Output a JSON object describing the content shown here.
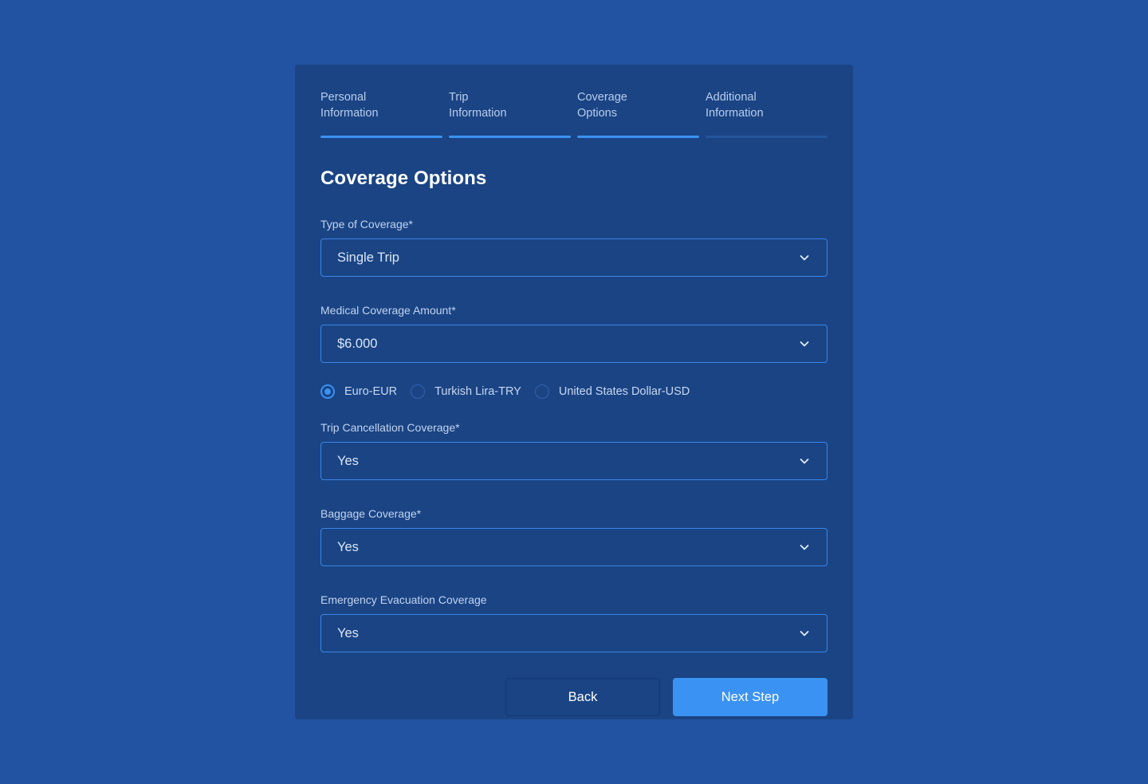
{
  "steps": [
    {
      "label": "Personal\nInformation",
      "state": "complete"
    },
    {
      "label": "Trip\nInformation",
      "state": "complete"
    },
    {
      "label": "Coverage\nOptions",
      "state": "active"
    },
    {
      "label": "Additional\nInformation",
      "state": "inactive"
    }
  ],
  "form": {
    "title": "Coverage Options",
    "type_of_coverage": {
      "label": "Type of Coverage*",
      "value": "Single Trip"
    },
    "medical_amount": {
      "label": "Medical Coverage Amount*",
      "value": "$6.000"
    },
    "currency": {
      "options": [
        {
          "label": "Euro-EUR",
          "checked": true
        },
        {
          "label": "Turkish Lira-TRY",
          "checked": false
        },
        {
          "label": "United States Dollar-USD",
          "checked": false
        }
      ]
    },
    "trip_cancellation": {
      "label": "Trip Cancellation Coverage*",
      "value": "Yes"
    },
    "baggage": {
      "label": "Baggage Coverage*",
      "value": "Yes"
    },
    "emergency_evacuation": {
      "label": "Emergency Evacuation Coverage",
      "value": "Yes"
    }
  },
  "actions": {
    "back_label": "Back",
    "next_label": "Next Step"
  },
  "icons": {
    "dropdown": "chevron-down-icon"
  },
  "colors": {
    "background": "#2253a3",
    "card": "#1a4484",
    "accent": "#3a92f2",
    "border": "#3a86e8"
  }
}
